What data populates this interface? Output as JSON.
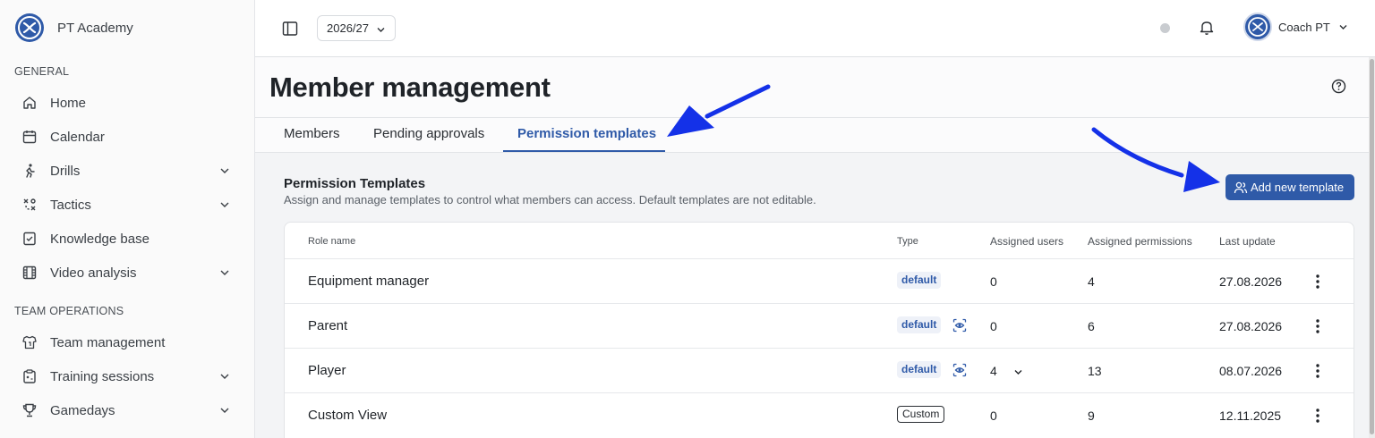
{
  "brand": {
    "name": "PT Academy"
  },
  "sidebar": {
    "sections": [
      {
        "label": "GENERAL"
      },
      {
        "label": "TEAM OPERATIONS"
      }
    ],
    "items": [
      {
        "label": "Home",
        "icon": "home-icon",
        "expandable": false
      },
      {
        "label": "Calendar",
        "icon": "calendar-icon",
        "expandable": false
      },
      {
        "label": "Drills",
        "icon": "runner-icon",
        "expandable": true
      },
      {
        "label": "Tactics",
        "icon": "tactics-icon",
        "expandable": true
      },
      {
        "label": "Knowledge base",
        "icon": "checklist-icon",
        "expandable": false
      },
      {
        "label": "Video analysis",
        "icon": "film-icon",
        "expandable": true
      },
      {
        "label": "Team management",
        "icon": "jersey-icon",
        "expandable": false
      },
      {
        "label": "Training sessions",
        "icon": "clipboard-icon",
        "expandable": true
      },
      {
        "label": "Gamedays",
        "icon": "trophy-icon",
        "expandable": true
      }
    ]
  },
  "topbar": {
    "season": "2026/27",
    "user_name": "Coach PT"
  },
  "page": {
    "title": "Member management",
    "tabs": [
      {
        "label": "Members",
        "active": false
      },
      {
        "label": "Pending approvals",
        "active": false
      },
      {
        "label": "Permission templates",
        "active": true
      }
    ],
    "section_title": "Permission Templates",
    "section_desc": "Assign and manage templates to control what members can access. Default templates are not editable.",
    "add_button": "Add new template"
  },
  "table": {
    "headers": {
      "role": "Role name",
      "type": "Type",
      "users": "Assigned users",
      "permissions": "Assigned permissions",
      "updated": "Last update"
    },
    "rows": [
      {
        "role": "Equipment manager",
        "type": "default",
        "has_view": false,
        "users": "0",
        "users_expand": false,
        "permissions": "4",
        "updated": "27.08.2026"
      },
      {
        "role": "Parent",
        "type": "default",
        "has_view": true,
        "users": "0",
        "users_expand": false,
        "permissions": "6",
        "updated": "27.08.2026"
      },
      {
        "role": "Player",
        "type": "default",
        "has_view": true,
        "users": "4",
        "users_expand": true,
        "permissions": "13",
        "updated": "08.07.2026"
      },
      {
        "role": "Custom View",
        "type": "Custom",
        "has_view": false,
        "users": "0",
        "users_expand": false,
        "permissions": "9",
        "updated": "12.11.2025"
      }
    ]
  },
  "colors": {
    "accent": "#2f5aa8",
    "annotation_arrow": "#1431e8"
  }
}
